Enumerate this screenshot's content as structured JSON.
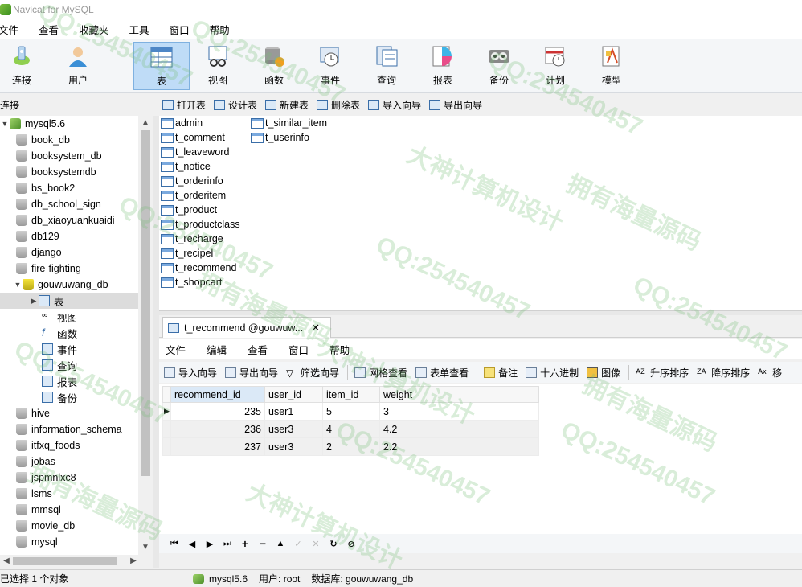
{
  "window": {
    "title": "Navicat for MySQL"
  },
  "menu": [
    "文件",
    "查看",
    "收藏夹",
    "工具",
    "窗口",
    "帮助"
  ],
  "toolbar": [
    {
      "label": "连接",
      "icon": "connection-icon"
    },
    {
      "label": "用户",
      "icon": "user-icon"
    },
    {
      "label": "表",
      "icon": "table-icon",
      "active": true
    },
    {
      "label": "视图",
      "icon": "view-icon"
    },
    {
      "label": "函数",
      "icon": "function-icon"
    },
    {
      "label": "事件",
      "icon": "event-icon"
    },
    {
      "label": "查询",
      "icon": "query-icon"
    },
    {
      "label": "报表",
      "icon": "report-icon"
    },
    {
      "label": "备份",
      "icon": "backup-icon"
    },
    {
      "label": "计划",
      "icon": "schedule-icon"
    },
    {
      "label": "模型",
      "icon": "model-icon"
    }
  ],
  "sidebar": {
    "header": "连接",
    "connection": "mysql5.6",
    "databases_before": [
      "book_db",
      "booksystem_db",
      "booksystemdb",
      "bs_book2",
      "db_school_sign",
      "db_xiaoyuankuaidi",
      "db129",
      "django",
      "fire-fighting"
    ],
    "open_db": "gouwuwang_db",
    "open_db_children": [
      "表",
      "视图",
      "函数",
      "事件",
      "查询",
      "报表",
      "备份"
    ],
    "databases_after": [
      "hive",
      "information_schema",
      "itfxq_foods",
      "jobas",
      "jspmnlxc8",
      "lsms",
      "mmsql",
      "movie_db",
      "mysql"
    ]
  },
  "object_toolbar": [
    "打开表",
    "设计表",
    "新建表",
    "删除表",
    "导入向导",
    "导出向导"
  ],
  "tables_col1": [
    "admin",
    "t_comment",
    "t_leaveword",
    "t_notice",
    "t_orderinfo",
    "t_orderitem",
    "t_product",
    "t_productclass",
    "t_recharge",
    "t_recipel",
    "t_recommend",
    "t_shopcart"
  ],
  "tables_col2": [
    "t_similar_item",
    "t_userinfo"
  ],
  "tab": {
    "label": "t_recommend @gouwuw...",
    "close": "✕"
  },
  "inner_menu": [
    "文件",
    "编辑",
    "查看",
    "窗口",
    "帮助"
  ],
  "inner_toolbar": [
    "导入向导",
    "导出向导",
    "筛选向导",
    "网格查看",
    "表单查看",
    "备注",
    "十六进制",
    "图像",
    "升序排序",
    "降序排序",
    "移"
  ],
  "grid": {
    "columns": [
      "recommend_id",
      "user_id",
      "item_id",
      "weight"
    ],
    "rows": [
      [
        "235",
        "user1",
        "5",
        "3"
      ],
      [
        "236",
        "user3",
        "4",
        "4.2"
      ],
      [
        "237",
        "user3",
        "2",
        "2.2"
      ]
    ]
  },
  "status": {
    "selection": "已选择 1 个对象",
    "server": "mysql5.6",
    "user": "用户: root",
    "database": "数据库: gouwuwang_db"
  },
  "watermarks": [
    "QQ:254540457",
    "大神计算机设计",
    "拥有海量源码"
  ]
}
